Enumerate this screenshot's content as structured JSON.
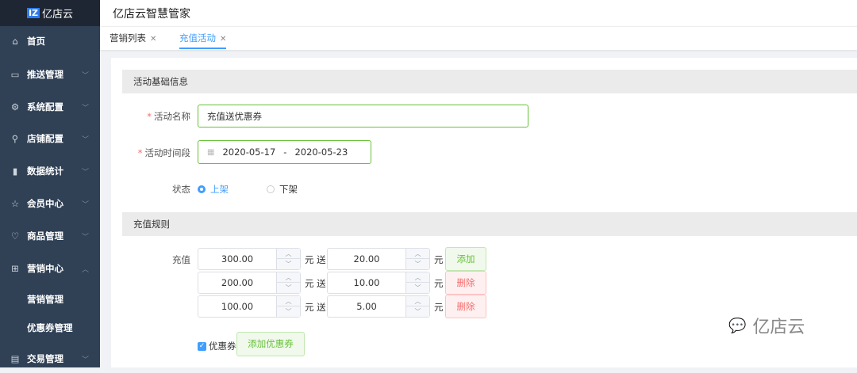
{
  "sidebar": {
    "logo_badge": "IZ",
    "logo_text": "亿店云",
    "items": [
      {
        "label": "首页",
        "icon": "⌂",
        "chev": false
      },
      {
        "label": "推送管理",
        "icon": "▭",
        "chev": true
      },
      {
        "label": "系统配置",
        "icon": "⚙",
        "chev": true
      },
      {
        "label": "店铺配置",
        "icon": "⚲",
        "chev": true
      },
      {
        "label": "数据统计",
        "icon": "▮",
        "chev": true
      },
      {
        "label": "会员中心",
        "icon": "☆",
        "chev": true
      },
      {
        "label": "商品管理",
        "icon": "♡",
        "chev": true
      },
      {
        "label": "营销中心",
        "icon": "⊞",
        "chev": true,
        "open": true
      }
    ],
    "sub_items": [
      "营销管理",
      "优惠券管理"
    ],
    "last_item": {
      "label": "交易管理",
      "icon": "▤"
    }
  },
  "header": {
    "title": "亿店云智慧管家"
  },
  "tabs": [
    {
      "label": "营销列表"
    },
    {
      "label": "充值活动",
      "active": true
    }
  ],
  "basic": {
    "section": "活动基础信息",
    "name_label": "活动名称",
    "name_value": "充值送优惠券",
    "period_label": "活动时间段",
    "start": "2020-05-17",
    "sep": "-",
    "end": "2020-05-23",
    "status_label": "状态",
    "status_on": "上架",
    "status_off": "下架",
    "status_selected": "上架"
  },
  "rules": {
    "section": "充值规则",
    "label": "充值",
    "unit_yuan": "元",
    "give": "送",
    "rows": [
      {
        "amount": "300.00",
        "bonus": "20.00",
        "action": "添加"
      },
      {
        "amount": "200.00",
        "bonus": "10.00",
        "action": "删除"
      },
      {
        "amount": "100.00",
        "bonus": "5.00",
        "action": "删除"
      }
    ],
    "coupon_label": "优惠券",
    "coupon_checked": true,
    "add_coupon": "添加优惠券"
  },
  "watermark": "亿店云"
}
